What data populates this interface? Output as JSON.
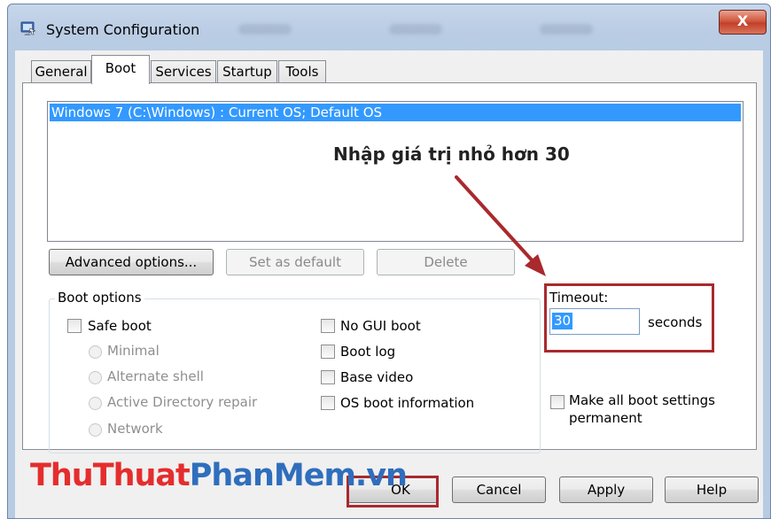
{
  "window": {
    "title": "System Configuration",
    "close_label": "X"
  },
  "tabs": [
    {
      "label": "General",
      "active": false
    },
    {
      "label": "Boot",
      "active": true
    },
    {
      "label": "Services",
      "active": false
    },
    {
      "label": "Startup",
      "active": false
    },
    {
      "label": "Tools",
      "active": false
    }
  ],
  "os_list": {
    "items": [
      "Windows 7 (C:\\Windows) : Current OS; Default OS"
    ],
    "selected_index": 0
  },
  "buttons": {
    "advanced": "Advanced options...",
    "set_default": "Set as default",
    "delete": "Delete"
  },
  "boot_options": {
    "title": "Boot options",
    "safe_boot": "Safe boot",
    "radios": [
      "Minimal",
      "Alternate shell",
      "Active Directory repair",
      "Network"
    ],
    "checks": [
      "No GUI boot",
      "Boot log",
      "Base video",
      "OS boot information"
    ]
  },
  "timeout": {
    "label": "Timeout:",
    "value": "30",
    "unit": "seconds"
  },
  "permanent": {
    "label_line1": "Make all boot settings",
    "label_line2": "permanent"
  },
  "footer": {
    "ok": "OK",
    "cancel": "Cancel",
    "apply": "Apply",
    "help": "Help"
  },
  "annotation": {
    "text": "Nhập giá trị nhỏ hơn 30",
    "color": "#a9292d"
  },
  "watermark": {
    "part1": "ThuThuat",
    "part2": "PhanMem",
    "part3": ".vn"
  },
  "colors": {
    "selection": "#3399ff",
    "highlight_box": "#a9292d"
  }
}
